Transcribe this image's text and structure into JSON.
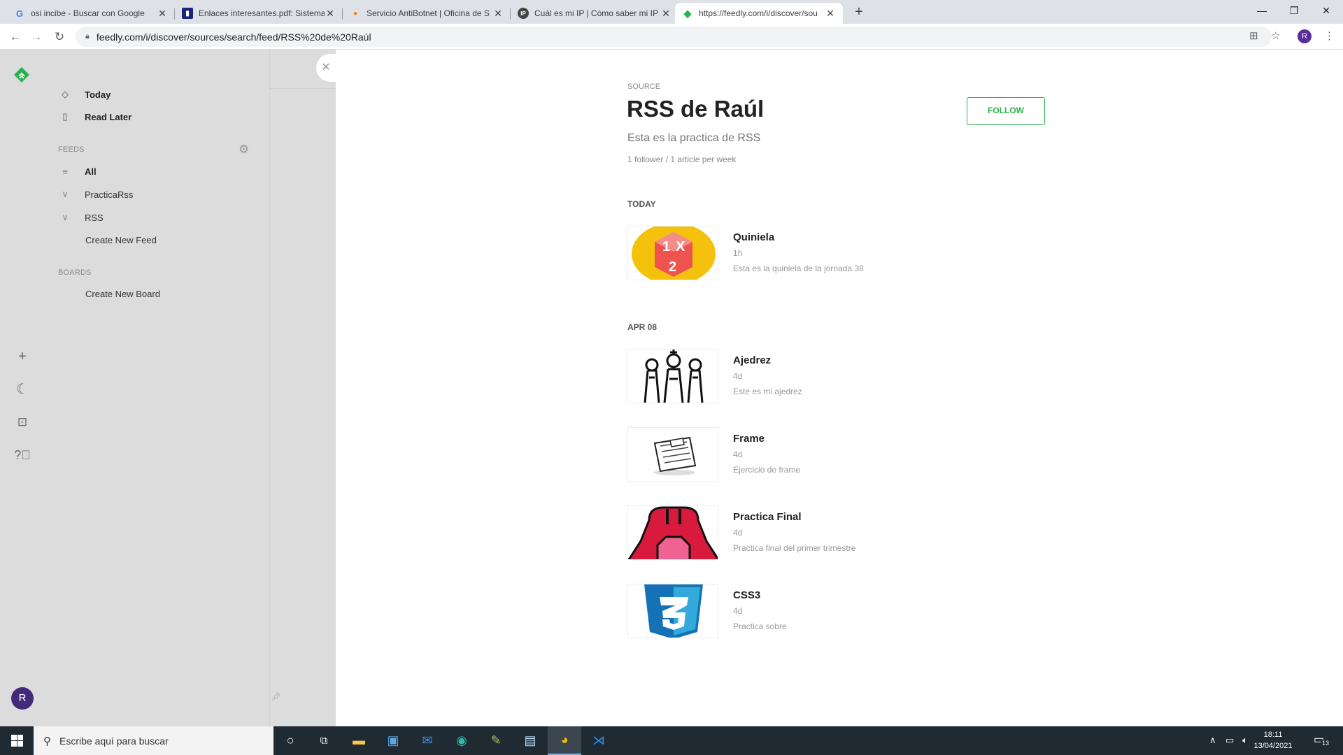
{
  "browser": {
    "tabs": [
      {
        "title": "osi incibe - Buscar con Google",
        "icon": "google-icon"
      },
      {
        "title": "Enlaces interesantes.pdf: Sistema",
        "icon": "pdf-icon"
      },
      {
        "title": "Servicio AntiBotnet | Oficina de S",
        "icon": "shield-icon"
      },
      {
        "title": "Cuál es mi IP | Cómo saber mi IP",
        "icon": "ip-icon"
      },
      {
        "title": "https://feedly.com/i/discover/sou",
        "icon": "feedly-icon"
      }
    ],
    "url": "feedly.com/i/discover/sources/search/feed/RSS%20de%20Raúl",
    "profile_initial": "R"
  },
  "sidebar": {
    "items": [
      {
        "label": "Today"
      },
      {
        "label": "Read Later"
      }
    ],
    "feeds_header": "FEEDS",
    "feeds": [
      {
        "label": "All"
      },
      {
        "label": "PracticaRss"
      },
      {
        "label": "RSS"
      },
      {
        "label": "Create New Feed"
      }
    ],
    "boards_header": "BOARDS",
    "boards": [
      {
        "label": "Create New Board"
      }
    ],
    "avatar_initial": "R"
  },
  "source": {
    "label": "SOURCE",
    "title": "RSS de Raúl",
    "description": "Esta es la practica de RSS",
    "meta": "1 follower / 1 article per week",
    "follow_label": "FOLLOW"
  },
  "groups": [
    {
      "label": "TODAY",
      "articles": [
        {
          "title": "Quiniela",
          "age": "1h",
          "summary": "Esta es la quiniela de la jornada 38",
          "thumb": "quiniela"
        }
      ]
    },
    {
      "label": "APR 08",
      "articles": [
        {
          "title": "Ajedrez",
          "age": "4d",
          "summary": "Este es mi ajedrez",
          "thumb": "chess"
        },
        {
          "title": "Frame",
          "age": "4d",
          "summary": "Ejercicio de frame",
          "thumb": "news"
        },
        {
          "title": "Practica Final",
          "age": "4d",
          "summary": "Practica final del primer trimestre",
          "thumb": "jacket"
        },
        {
          "title": "CSS3",
          "age": "4d",
          "summary": "Practica sobre",
          "thumb": "css3"
        }
      ]
    }
  ],
  "taskbar": {
    "search_placeholder": "Escribe aquí para buscar",
    "time": "18:11",
    "date": "13/04/2021",
    "notifications": "13"
  }
}
